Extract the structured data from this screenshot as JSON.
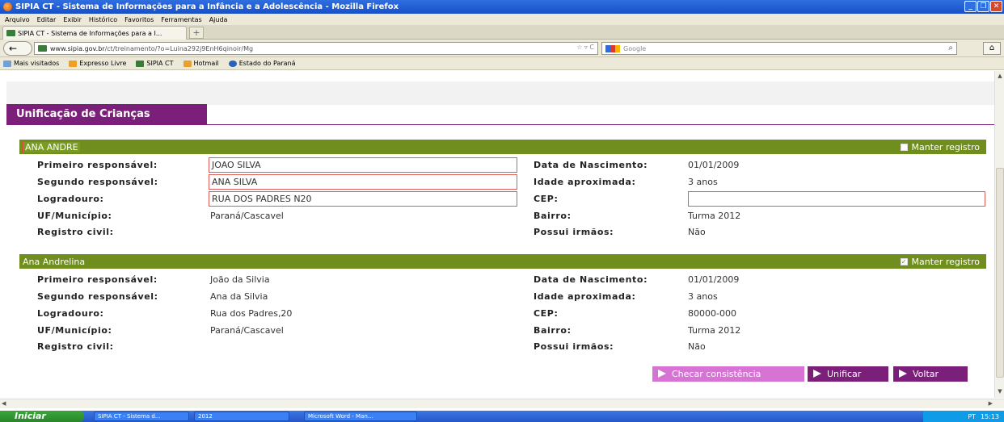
{
  "window": {
    "title": "SIPIA CT - Sistema de Informações para a Infância e a Adolescência - Mozilla Firefox",
    "min": "_",
    "max": "❐",
    "close": "✕"
  },
  "menu": [
    "Arquivo",
    "Editar",
    "Exibir",
    "Histórico",
    "Favoritos",
    "Ferramentas",
    "Ajuda"
  ],
  "tab": {
    "label": "SIPIA CT - Sistema de Informações para a I...",
    "new": "+"
  },
  "nav": {
    "back": "←",
    "url_host": "www.sipia.gov.br",
    "url_path": "/ct/treinamento/?o=Luina292j9EnH6qinoir/Mg",
    "url_icons": "☆ ▿ C",
    "search_placeholder": "Google",
    "search_icon": "⌕",
    "home": "⌂"
  },
  "bookmarks": [
    "Mais visitados",
    "Expresso Livre",
    "SIPIA CT",
    "Hotmail",
    "Estado do Paraná"
  ],
  "page": {
    "heading": "Unificação de Crianças"
  },
  "labels": {
    "resp1": "Primeiro responsável:",
    "resp2": "Segundo responsável:",
    "logradouro": "Logradouro:",
    "uf": "UF/Município:",
    "registro": "Registro civil:",
    "nasc": "Data de Nascimento:",
    "idade": "Idade aproximada:",
    "cep": "CEP:",
    "bairro": "Bairro:",
    "irmaos": "Possui irmãos:"
  },
  "records": [
    {
      "name": "ANA ANDRE",
      "keep_label": "Manter registro",
      "keep_checked": false,
      "resp1": "JOAO SILVA",
      "resp2": "ANA SILVA",
      "logradouro": "RUA DOS PADRES N20",
      "uf": "Paraná/Cascavel",
      "registro": "",
      "nasc": "01/01/2009",
      "idade": "3 anos",
      "cep": "",
      "bairro": "Turma 2012",
      "irmaos": "Não"
    },
    {
      "name": "Ana Andrelina",
      "keep_label": "Manter registro",
      "keep_checked": true,
      "resp1": "João da Silvia",
      "resp2": "Ana da Silvia",
      "logradouro": "Rua dos Padres,20",
      "uf": "Paraná/Cascavel",
      "registro": "",
      "nasc": "01/01/2009",
      "idade": "3 anos",
      "cep": "80000-000",
      "bairro": "Turma 2012",
      "irmaos": "Não"
    }
  ],
  "buttons": {
    "check": "Checar consistência",
    "merge": "Unificar",
    "back": "Voltar"
  },
  "taskbar": {
    "start": "Iniciar",
    "tasks": [
      "SIPIA CT - Sistema d...",
      "2012",
      "Microsoft Word - Man..."
    ],
    "lang": "PT",
    "time": "15:13"
  },
  "colors": {
    "purple": "#7b1f7a",
    "green": "#6f8e1e",
    "pink": "#d873d6",
    "error_border": "#e05a5a"
  }
}
